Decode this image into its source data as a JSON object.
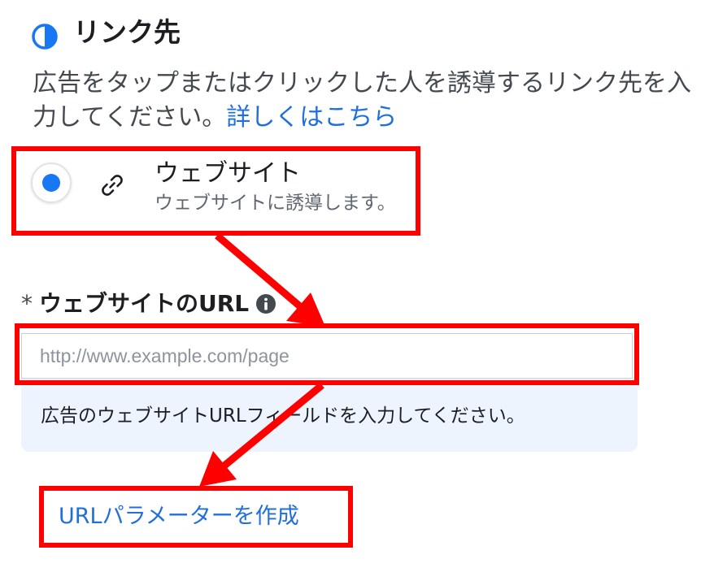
{
  "section": {
    "title": "リンク先",
    "icon": "half-circle-icon",
    "description": "広告をタップまたはクリックした人を誘導するリンク先を入力してください。",
    "learn_more_link": "詳しくはこちら"
  },
  "destination_option": {
    "selected": true,
    "icon": "link-icon",
    "title": "ウェブサイト",
    "subtitle": "ウェブサイトに誘導します。"
  },
  "website_url": {
    "required_marker": "*",
    "label": "ウェブサイトのURL",
    "info_icon": "info-icon",
    "value": "",
    "placeholder": "http://www.example.com/page",
    "hint": "広告のウェブサイトURLフィールドを入力してください。"
  },
  "url_parameters_link": "URLパラメーターを作成",
  "colors": {
    "accent": "#1877f2",
    "link": "#216fdb",
    "annotation": "#ff0000",
    "hint_background": "#edf4fe"
  }
}
